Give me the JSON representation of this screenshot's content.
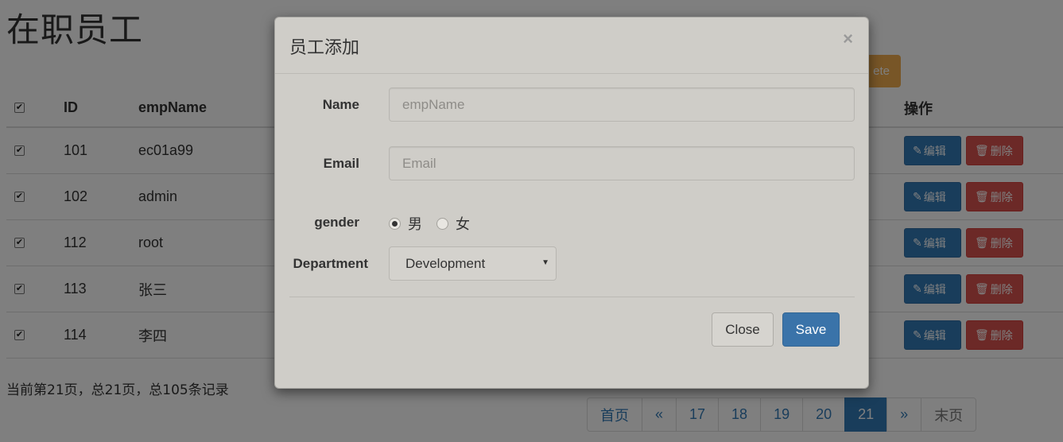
{
  "page": {
    "title": "在职员工",
    "delete_button_partial": "ete",
    "table": {
      "columns": {
        "id": "ID",
        "name": "empName",
        "actions": "操作"
      },
      "rows": [
        {
          "id": "101",
          "name": "ec01a99"
        },
        {
          "id": "102",
          "name": "admin"
        },
        {
          "id": "112",
          "name": "root"
        },
        {
          "id": "113",
          "name": "张三"
        },
        {
          "id": "114",
          "name": "李四"
        }
      ],
      "edit_label": "编辑",
      "delete_label": "删除",
      "edit_icon": "pencil-icon",
      "delete_icon": "trash-icon"
    },
    "page_info": "当前第21页，总21页，总105条记录",
    "pagination": [
      "首页",
      "«",
      "17",
      "18",
      "19",
      "20",
      "21",
      "»",
      "末页"
    ],
    "current_page": "21"
  },
  "modal": {
    "title": "员工添加",
    "close_symbol": "×",
    "fields": {
      "name_label": "Name",
      "name_placeholder": "empName",
      "email_label": "Email",
      "email_placeholder": "Email",
      "gender_label": "gender",
      "gender_options": [
        "男",
        "女"
      ],
      "gender_selected": "男",
      "department_label": "Department",
      "department_value": "Development"
    },
    "close_button": "Close",
    "save_button": "Save"
  },
  "colors": {
    "primary": "#337ab7",
    "danger": "#d9534f",
    "warning": "#f0ad4e",
    "modal_bg": "#cfcdc8"
  }
}
